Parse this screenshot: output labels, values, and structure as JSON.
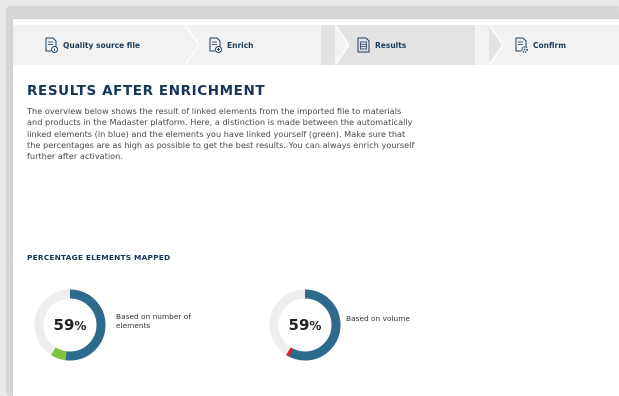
{
  "steps": [
    {
      "label": "Quality source file",
      "icon": "document-info-icon"
    },
    {
      "label": "Enrich",
      "icon": "document-add-icon"
    },
    {
      "label": "Results",
      "icon": "document-list-icon"
    },
    {
      "label": "Confirm",
      "icon": "document-settings-icon"
    }
  ],
  "active_step": "Results",
  "page": {
    "title": "RESULTS AFTER ENRICHMENT",
    "description": "The overview below shows the result of linked elements from the imported file to materials and products in the Madaster platform. Here, a distinction is made between the automatically linked elements (in blue) and the elements you have linked yourself (green). Make sure that the percentages are as high as possible to get the best results. You can always enrich yourself further after activation."
  },
  "mapped": {
    "heading": "PERCENTAGE ELEMENTS MAPPED",
    "gauges": [
      {
        "value": "59",
        "unit": "%",
        "label": "Based on number of elements",
        "auto_fraction": 0.52,
        "manual_fraction": 0.07
      },
      {
        "value": "59",
        "unit": "%",
        "label": "Based on volume",
        "auto_fraction": 0.575,
        "manual_fraction": 0.015
      }
    ]
  },
  "colors": {
    "auto_linked": "#2e6a8c",
    "manual_linked": "#7dc242",
    "warning": "#e02020",
    "track": "#eeeeee",
    "title": "#15365a"
  }
}
